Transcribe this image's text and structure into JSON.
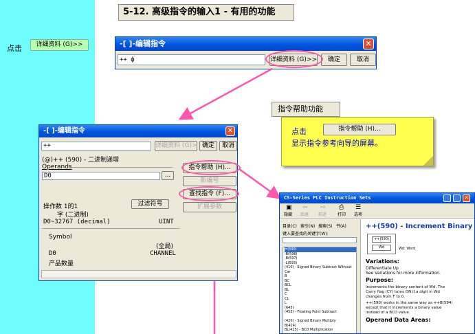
{
  "slide": {
    "title": "5-12. 高级指令的输入1 - 有用的功能",
    "side_click_label": "点击",
    "side_button": "详细资料 (G)>>"
  },
  "dialog_small": {
    "title": "-[ ]-编辑指令",
    "input_value": "++ ф",
    "detail_button": "详细资料 (G)>>",
    "ok_button": "确定",
    "cancel_button": "取消"
  },
  "callout": {
    "tab": "指令帮助功能",
    "click_label": "点击",
    "button": "指令帮助 (H)...",
    "description": "显示指令参考向导的屏幕。"
  },
  "dialog_big": {
    "title": "-[ ]-编辑指令",
    "input_value": "++",
    "detail_button": "详细资料 (G)>>",
    "ok_button": "确定",
    "cancel_button": "取消",
    "instruction_desc": "(@)++ (590) - 二进制递增",
    "operands_label": "Operands",
    "operand_value": "D0",
    "browse_button": "...",
    "help_button": "指令帮助 (H)...",
    "disabled_button_1": "新编号",
    "find_button": "查找指令 (F)...",
    "disabled_button_2": "扩展参数",
    "operand_count": "操作数 1的1",
    "filter_button": "过滤符号",
    "word_type": "字 (二进制)",
    "range": "D0~32767 (decimal)",
    "uint": "UINT",
    "symbol_label": "Symbol",
    "global_label": "(全局)",
    "d0": "D0",
    "channel": "CHANNEL",
    "product_qty": "产品数量"
  },
  "help_window": {
    "title": "CS-Series PLC Instruction Sets",
    "toolbar": [
      "隐藏",
      "后退",
      "前进",
      "打印",
      "选项"
    ],
    "tabs": [
      "目录(C)",
      "索引(N)",
      "搜索(S)",
      "书(A)"
    ],
    "keyword_label": "键入要查找的关键字(W):",
    "list_items": [
      "=(590)",
      "-B(596)",
      "-B(597)",
      "-L(593)",
      "(410) - Signed Binary Subtract Without Car",
      "B",
      "BC",
      "BCL",
      "BL",
      "C",
      "CL",
      "L",
      "(645)",
      "(455) - Floating Point Subtract",
      "",
      "(420) - Signed Binary Multiply",
      "B(424)",
      "BL(425) - BCD Multiplication"
    ],
    "heading": "++(590) - Increment Binary",
    "diagram_label": "++(590)",
    "diagram_wd": "Wd",
    "diagram_wdword": "Wd: Word",
    "variations_heading": "Variations:",
    "variations_line1": "Differentiate Up",
    "variations_line2": "See Variations for more information.",
    "purpose_heading": "Purpose:",
    "purpose_text": [
      "Increments the binary content of Wd. The",
      "Carry flag (CY) turns ON if a digit in Wd",
      "changes from F to 0.",
      "++(590) works in the same way as ++B(594)",
      "except that it increments a binary value",
      "instead of a BCD value."
    ],
    "operand_heading": "Operand Data Areas:"
  }
}
